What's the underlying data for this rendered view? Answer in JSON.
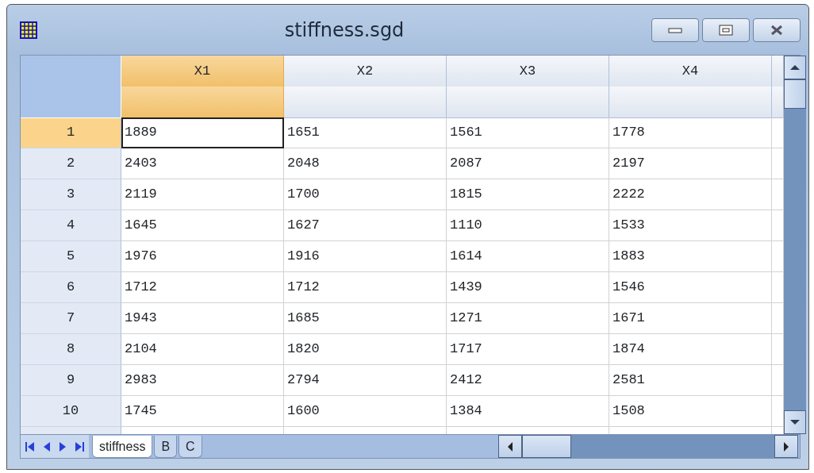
{
  "window": {
    "title": "stiffness.sgd"
  },
  "columns": [
    {
      "label": "X1",
      "selected": true
    },
    {
      "label": "X2",
      "selected": false
    },
    {
      "label": "X3",
      "selected": false
    },
    {
      "label": "X4",
      "selected": false
    }
  ],
  "rows": [
    {
      "label": "1",
      "selected": true,
      "cells": [
        {
          "value": "1889",
          "selected": true
        },
        {
          "value": "1651",
          "selected": false
        },
        {
          "value": "1561",
          "selected": false
        },
        {
          "value": "1778",
          "selected": false
        }
      ]
    },
    {
      "label": "2",
      "selected": false,
      "cells": [
        {
          "value": "2403",
          "selected": false
        },
        {
          "value": "2048",
          "selected": false
        },
        {
          "value": "2087",
          "selected": false
        },
        {
          "value": "2197",
          "selected": false
        }
      ]
    },
    {
      "label": "3",
      "selected": false,
      "cells": [
        {
          "value": "2119",
          "selected": false
        },
        {
          "value": "1700",
          "selected": false
        },
        {
          "value": "1815",
          "selected": false
        },
        {
          "value": "2222",
          "selected": false
        }
      ]
    },
    {
      "label": "4",
      "selected": false,
      "cells": [
        {
          "value": "1645",
          "selected": false
        },
        {
          "value": "1627",
          "selected": false
        },
        {
          "value": "1110",
          "selected": false
        },
        {
          "value": "1533",
          "selected": false
        }
      ]
    },
    {
      "label": "5",
      "selected": false,
      "cells": [
        {
          "value": "1976",
          "selected": false
        },
        {
          "value": "1916",
          "selected": false
        },
        {
          "value": "1614",
          "selected": false
        },
        {
          "value": "1883",
          "selected": false
        }
      ]
    },
    {
      "label": "6",
      "selected": false,
      "cells": [
        {
          "value": "1712",
          "selected": false
        },
        {
          "value": "1712",
          "selected": false
        },
        {
          "value": "1439",
          "selected": false
        },
        {
          "value": "1546",
          "selected": false
        }
      ]
    },
    {
      "label": "7",
      "selected": false,
      "cells": [
        {
          "value": "1943",
          "selected": false
        },
        {
          "value": "1685",
          "selected": false
        },
        {
          "value": "1271",
          "selected": false
        },
        {
          "value": "1671",
          "selected": false
        }
      ]
    },
    {
      "label": "8",
      "selected": false,
      "cells": [
        {
          "value": "2104",
          "selected": false
        },
        {
          "value": "1820",
          "selected": false
        },
        {
          "value": "1717",
          "selected": false
        },
        {
          "value": "1874",
          "selected": false
        }
      ]
    },
    {
      "label": "9",
      "selected": false,
      "cells": [
        {
          "value": "2983",
          "selected": false
        },
        {
          "value": "2794",
          "selected": false
        },
        {
          "value": "2412",
          "selected": false
        },
        {
          "value": "2581",
          "selected": false
        }
      ]
    },
    {
      "label": "10",
      "selected": false,
      "cells": [
        {
          "value": "1745",
          "selected": false
        },
        {
          "value": "1600",
          "selected": false
        },
        {
          "value": "1384",
          "selected": false
        },
        {
          "value": "1508",
          "selected": false
        }
      ]
    }
  ],
  "sheet_tabs": [
    {
      "label": "stiffness",
      "selected": true
    },
    {
      "label": "B",
      "selected": false
    },
    {
      "label": "C",
      "selected": false
    }
  ]
}
